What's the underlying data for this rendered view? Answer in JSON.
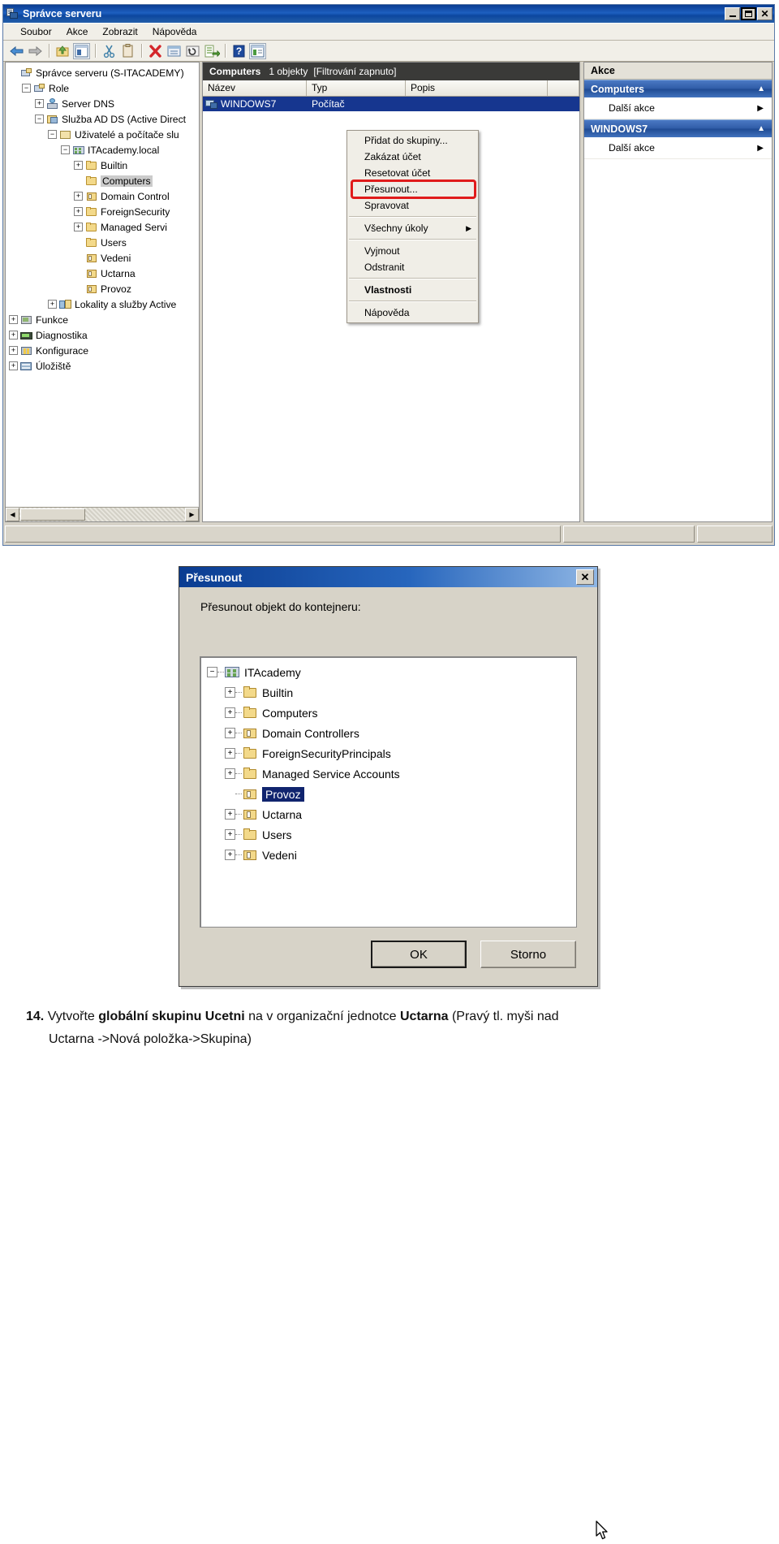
{
  "window": {
    "title": "Správce serveru",
    "app_icon": "server-icon",
    "controls": {
      "minimize": "_",
      "maximize": "□",
      "close": "✕"
    },
    "menus": [
      "Soubor",
      "Akce",
      "Zobrazit",
      "Nápověda"
    ],
    "toolbar_icons": [
      "back-arrow-icon",
      "forward-arrow-icon",
      "up-folder-icon",
      "show-hide-tree-icon",
      "cut-icon",
      "paste-icon",
      "delete-icon",
      "properties-icon",
      "refresh-icon",
      "export-list-icon",
      "help-icon",
      "show-action-pane-icon"
    ]
  },
  "tree": {
    "nodes": [
      {
        "label": "Správce serveru (S-ITACADEMY)",
        "indent": 0,
        "expander": "none",
        "icon": "server-manager-icon",
        "selected": false
      },
      {
        "label": "Role",
        "indent": 1,
        "expander": "minus",
        "icon": "roles-icon",
        "selected": false
      },
      {
        "label": "Server DNS",
        "indent": 2,
        "expander": "plus",
        "icon": "dns-icon",
        "selected": false
      },
      {
        "label": "Služba AD DS (Active Direct",
        "indent": 2,
        "expander": "minus",
        "icon": "adds-icon",
        "selected": false
      },
      {
        "label": "Uživatelé a počítače slu",
        "indent": 3,
        "expander": "minus",
        "icon": "snapin-icon",
        "selected": false
      },
      {
        "label": "ITAcademy.local",
        "indent": 4,
        "expander": "minus",
        "icon": "domain-icon",
        "selected": false
      },
      {
        "label": "Builtin",
        "indent": 5,
        "expander": "plus",
        "icon": "folder-icon",
        "selected": false
      },
      {
        "label": "Computers",
        "indent": 5,
        "expander": "none",
        "icon": "folder-icon",
        "selected": true
      },
      {
        "label": "Domain Control",
        "indent": 5,
        "expander": "plus",
        "icon": "ou-icon",
        "selected": false
      },
      {
        "label": "ForeignSecurity",
        "indent": 5,
        "expander": "plus",
        "icon": "folder-icon",
        "selected": false
      },
      {
        "label": "Managed Servi",
        "indent": 5,
        "expander": "plus",
        "icon": "folder-icon",
        "selected": false
      },
      {
        "label": "Users",
        "indent": 5,
        "expander": "none",
        "icon": "folder-icon",
        "selected": false
      },
      {
        "label": "Vedeni",
        "indent": 5,
        "expander": "none",
        "icon": "ou-icon",
        "selected": false
      },
      {
        "label": "Uctarna",
        "indent": 5,
        "expander": "none",
        "icon": "ou-icon",
        "selected": false
      },
      {
        "label": "Provoz",
        "indent": 5,
        "expander": "none",
        "icon": "ou-icon",
        "selected": false
      },
      {
        "label": "Lokality a služby Active",
        "indent": 3,
        "expander": "plus",
        "icon": "sites-services-icon",
        "selected": false
      },
      {
        "label": "Funkce",
        "indent": 0,
        "expander": "plus",
        "icon": "features-icon",
        "selected": false
      },
      {
        "label": "Diagnostika",
        "indent": 0,
        "expander": "plus",
        "icon": "diagnostics-icon",
        "selected": false
      },
      {
        "label": "Konfigurace",
        "indent": 0,
        "expander": "plus",
        "icon": "configuration-icon",
        "selected": false
      },
      {
        "label": "Úložiště",
        "indent": 0,
        "expander": "plus",
        "icon": "storage-icon",
        "selected": false
      }
    ]
  },
  "list_pane": {
    "header": {
      "title": "Computers",
      "count": "1 objekty",
      "filter": "[Filtrování zapnuto]"
    },
    "columns": [
      "Název",
      "Typ",
      "Popis",
      ""
    ],
    "rows": [
      {
        "name": "WINDOWS7",
        "type": "Počítač",
        "description": "",
        "icon": "computer-icon",
        "selected": true
      }
    ]
  },
  "actions_pane": {
    "title": "Akce",
    "groups": [
      {
        "header": "Computers",
        "items": [
          {
            "label": "Další akce",
            "has_submenu": true
          }
        ]
      },
      {
        "header": "WINDOWS7",
        "items": [
          {
            "label": "Další akce",
            "has_submenu": true
          }
        ]
      }
    ],
    "collapse_caret": "▲",
    "submenu_arrow": "▶"
  },
  "context_menu": {
    "items": [
      {
        "label": "Přidat do skupiny...",
        "type": "item"
      },
      {
        "label": "Zakázat účet",
        "type": "item"
      },
      {
        "label": "Resetovat účet",
        "type": "item"
      },
      {
        "label": "Přesunout...",
        "type": "item",
        "highlighted": true
      },
      {
        "label": "Spravovat",
        "type": "item"
      },
      {
        "label": "",
        "type": "separator"
      },
      {
        "label": "Všechny úkoly",
        "type": "item",
        "has_submenu": true
      },
      {
        "label": "",
        "type": "separator"
      },
      {
        "label": "Vyjmout",
        "type": "item"
      },
      {
        "label": "Odstranit",
        "type": "item"
      },
      {
        "label": "",
        "type": "separator"
      },
      {
        "label": "Vlastnosti",
        "type": "item",
        "bold": true
      },
      {
        "label": "",
        "type": "separator"
      },
      {
        "label": "Nápověda",
        "type": "item"
      }
    ],
    "submenu_arrow": "▶",
    "highlight_color": "#e01b1b"
  },
  "dialog": {
    "title": "Přesunout",
    "close_label": "✕",
    "prompt": "Přesunout objekt do kontejneru:",
    "tree": [
      {
        "label": "ITAcademy",
        "indent": 0,
        "expander": "minus",
        "icon": "domain-icon",
        "selected": false
      },
      {
        "label": "Builtin",
        "indent": 1,
        "expander": "plus",
        "icon": "folder-icon",
        "selected": false
      },
      {
        "label": "Computers",
        "indent": 1,
        "expander": "plus",
        "icon": "folder-icon",
        "selected": false
      },
      {
        "label": "Domain Controllers",
        "indent": 1,
        "expander": "plus",
        "icon": "ou-icon",
        "selected": false
      },
      {
        "label": "ForeignSecurityPrincipals",
        "indent": 1,
        "expander": "plus",
        "icon": "folder-icon",
        "selected": false
      },
      {
        "label": "Managed Service Accounts",
        "indent": 1,
        "expander": "plus",
        "icon": "folder-icon",
        "selected": false
      },
      {
        "label": "Provoz",
        "indent": 1,
        "expander": "none",
        "icon": "ou-icon",
        "selected": true
      },
      {
        "label": "Uctarna",
        "indent": 1,
        "expander": "plus",
        "icon": "ou-icon",
        "selected": false
      },
      {
        "label": "Users",
        "indent": 1,
        "expander": "plus",
        "icon": "folder-icon",
        "selected": false
      },
      {
        "label": "Vedeni",
        "indent": 1,
        "expander": "plus",
        "icon": "ou-icon",
        "selected": false
      }
    ],
    "ok_label": "OK",
    "cancel_label": "Storno"
  },
  "caption": {
    "number": "14.",
    "part1": "Vytvořte ",
    "bold1": "globální skupinu Ucetni",
    "part2": " na v organizační jednotce ",
    "bold2": "Uctarna",
    "part3": " (Pravý tl. myši nad",
    "line2": "Uctarna ->Nová položka->Skupina)"
  }
}
